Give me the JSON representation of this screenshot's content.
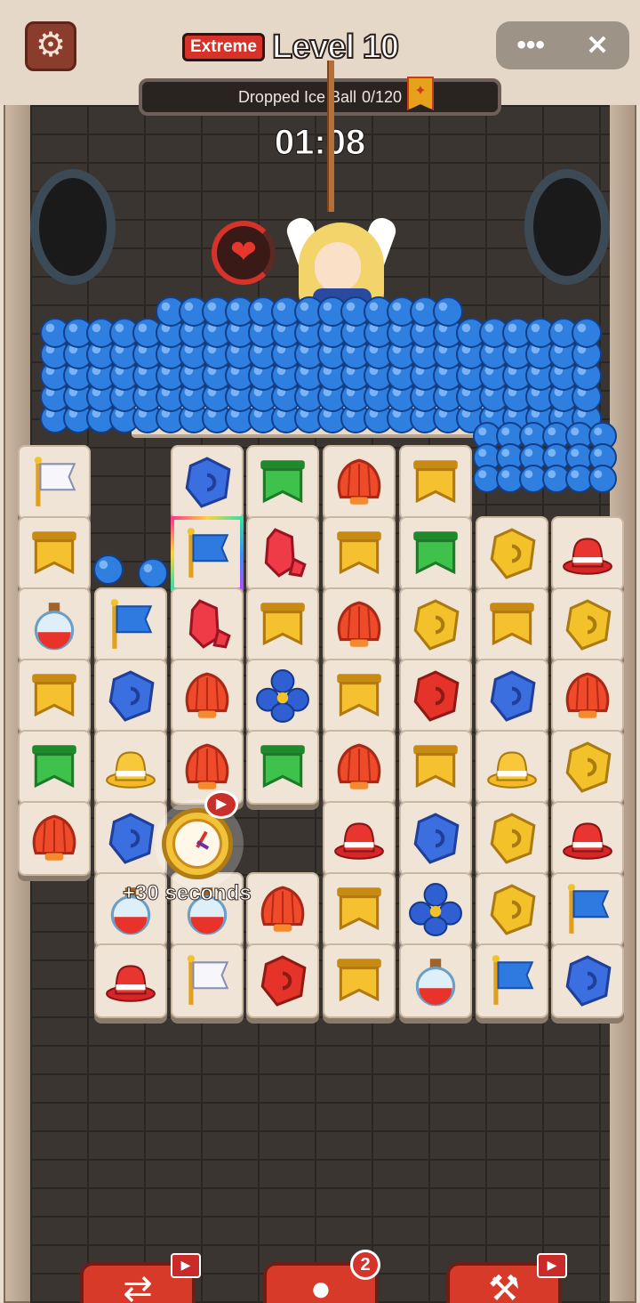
{
  "header": {
    "difficulty": "Extreme",
    "level": "Level 10",
    "goal_text": "Dropped Ice Ball",
    "goal_progress": "0/120",
    "timer": "01:08",
    "menu_label": "•••",
    "close_label": "✕",
    "settings_icon": "⚙"
  },
  "bonus": {
    "text": "+30 seconds"
  },
  "bottom_bar": {
    "hint_count": "2",
    "shuffle_icon": "⇄",
    "hint_icon": "●",
    "hammer_icon": "⚒",
    "video_tag": "▶"
  },
  "board": {
    "tiles": [
      {
        "c": 0,
        "r": 0,
        "kind": "flag-white"
      },
      {
        "c": 2,
        "r": 0,
        "kind": "gem-blue"
      },
      {
        "c": 3,
        "r": 0,
        "kind": "banner-green"
      },
      {
        "c": 4,
        "r": 0,
        "kind": "shell"
      },
      {
        "c": 5,
        "r": 0,
        "kind": "banner-yellow"
      },
      {
        "c": 0,
        "r": 1,
        "kind": "banner-yellow"
      },
      {
        "c": 2,
        "r": 1,
        "kind": "flag-blue",
        "selected": true
      },
      {
        "c": 3,
        "r": 1,
        "kind": "crystal"
      },
      {
        "c": 4,
        "r": 1,
        "kind": "banner-yellow"
      },
      {
        "c": 5,
        "r": 1,
        "kind": "banner-green"
      },
      {
        "c": 6,
        "r": 1,
        "kind": "gem-yellow"
      },
      {
        "c": 7,
        "r": 1,
        "kind": "hat-red"
      },
      {
        "c": 0,
        "r": 2,
        "kind": "potion"
      },
      {
        "c": 1,
        "r": 2,
        "kind": "flag-blue"
      },
      {
        "c": 2,
        "r": 2,
        "kind": "crystal"
      },
      {
        "c": 3,
        "r": 2,
        "kind": "banner-yellow"
      },
      {
        "c": 4,
        "r": 2,
        "kind": "shell"
      },
      {
        "c": 5,
        "r": 2,
        "kind": "gem-yellow"
      },
      {
        "c": 6,
        "r": 2,
        "kind": "banner-yellow"
      },
      {
        "c": 7,
        "r": 2,
        "kind": "gem-yellow"
      },
      {
        "c": 0,
        "r": 3,
        "kind": "banner-yellow"
      },
      {
        "c": 1,
        "r": 3,
        "kind": "gem-blue"
      },
      {
        "c": 2,
        "r": 3,
        "kind": "shell"
      },
      {
        "c": 3,
        "r": 3,
        "kind": "flower"
      },
      {
        "c": 4,
        "r": 3,
        "kind": "banner-yellow"
      },
      {
        "c": 5,
        "r": 3,
        "kind": "gem-red"
      },
      {
        "c": 6,
        "r": 3,
        "kind": "gem-blue"
      },
      {
        "c": 7,
        "r": 3,
        "kind": "shell"
      },
      {
        "c": 0,
        "r": 4,
        "kind": "banner-green"
      },
      {
        "c": 1,
        "r": 4,
        "kind": "hat-yellow"
      },
      {
        "c": 2,
        "r": 4,
        "kind": "shell"
      },
      {
        "c": 3,
        "r": 4,
        "kind": "banner-green"
      },
      {
        "c": 4,
        "r": 4,
        "kind": "shell"
      },
      {
        "c": 5,
        "r": 4,
        "kind": "banner-yellow"
      },
      {
        "c": 6,
        "r": 4,
        "kind": "hat-yellow"
      },
      {
        "c": 7,
        "r": 4,
        "kind": "gem-yellow"
      },
      {
        "c": 0,
        "r": 5,
        "kind": "shell"
      },
      {
        "c": 1,
        "r": 5,
        "kind": "gem-blue"
      },
      {
        "c": 4,
        "r": 5,
        "kind": "hat-red"
      },
      {
        "c": 5,
        "r": 5,
        "kind": "gem-blue"
      },
      {
        "c": 6,
        "r": 5,
        "kind": "gem-yellow"
      },
      {
        "c": 7,
        "r": 5,
        "kind": "hat-red"
      },
      {
        "c": 1,
        "r": 6,
        "kind": "potion"
      },
      {
        "c": 2,
        "r": 6,
        "kind": "potion"
      },
      {
        "c": 3,
        "r": 6,
        "kind": "shell"
      },
      {
        "c": 4,
        "r": 6,
        "kind": "banner-yellow"
      },
      {
        "c": 5,
        "r": 6,
        "kind": "flower"
      },
      {
        "c": 6,
        "r": 6,
        "kind": "gem-yellow"
      },
      {
        "c": 7,
        "r": 6,
        "kind": "flag-blue"
      },
      {
        "c": 1,
        "r": 7,
        "kind": "hat-red"
      },
      {
        "c": 2,
        "r": 7,
        "kind": "flag-white"
      },
      {
        "c": 3,
        "r": 7,
        "kind": "gem-red"
      },
      {
        "c": 4,
        "r": 7,
        "kind": "banner-yellow"
      },
      {
        "c": 5,
        "r": 7,
        "kind": "potion"
      },
      {
        "c": 6,
        "r": 7,
        "kind": "flag-blue"
      },
      {
        "c": 7,
        "r": 7,
        "kind": "gem-blue"
      }
    ]
  },
  "colors": {
    "accent_red": "#d6332a",
    "ice_ball": "#2f7fe0",
    "tile_bg": "#efe4d6"
  }
}
